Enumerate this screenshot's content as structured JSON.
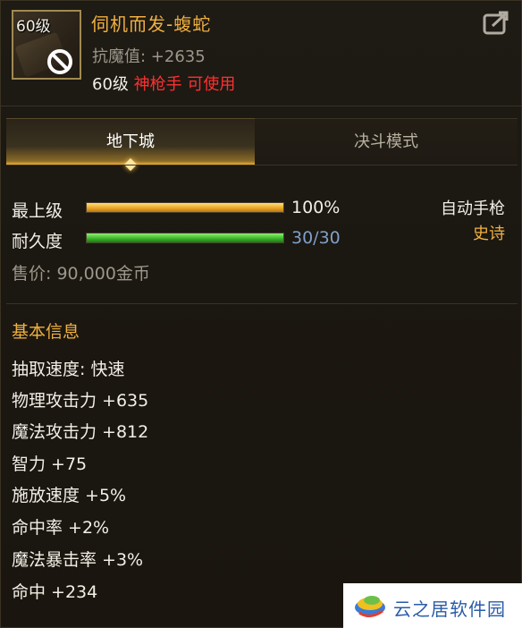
{
  "item": {
    "level_badge": "60级",
    "name": "伺机而发-蝮蛇",
    "magic_resistance": "抗魔值: +2635",
    "requirement_level": "60级",
    "requirement_class": "神枪手 可使用"
  },
  "tabs": [
    {
      "label": "地下城",
      "active": true
    },
    {
      "label": "决斗模式",
      "active": false
    }
  ],
  "stats": {
    "upgrade_label": "最上级",
    "upgrade_value": "100%",
    "upgrade_fraction": 1.0,
    "durability_label": "耐久度",
    "durability_value": "30/30",
    "durability_fraction": 1.0,
    "weapon_type": "自动手枪",
    "rarity": "史诗",
    "price": "售价: 90,000金币"
  },
  "basic_info": {
    "title": "基本信息",
    "attributes": [
      "抽取速度: 快速",
      "物理攻击力 +635",
      "魔法攻击力 +812",
      "智力 +75",
      "施放速度 +5%",
      "命中率 +2%",
      "魔法暴击率 +3%",
      "命中 +234"
    ]
  },
  "watermark": {
    "text": "云之居软件园"
  },
  "colors": {
    "accent_gold": "#f0b040",
    "class_red": "#ff3030",
    "durability_value": "#7fa0c8"
  }
}
